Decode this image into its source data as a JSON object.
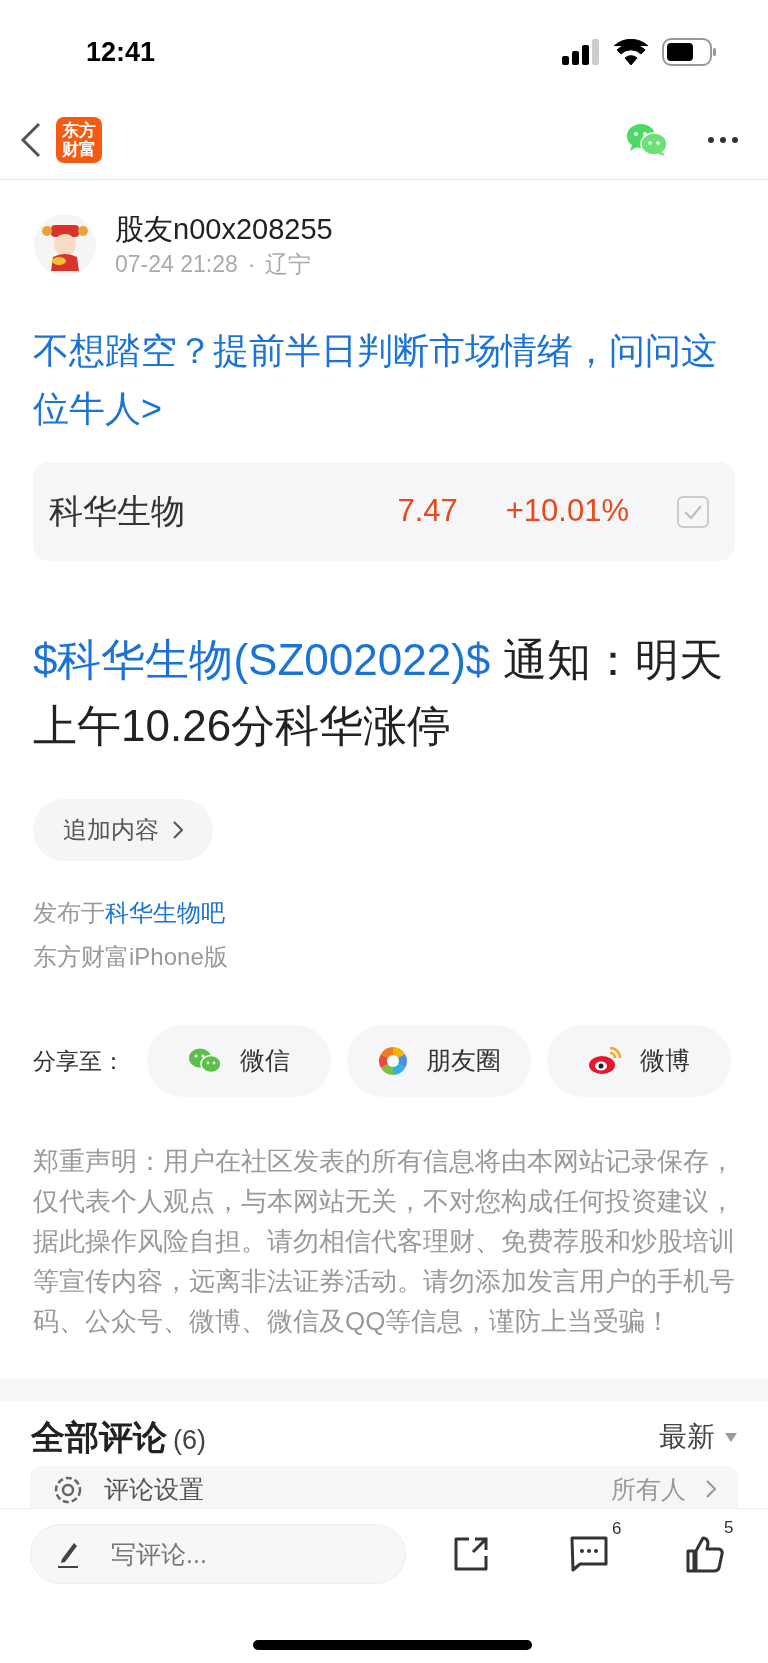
{
  "status_bar": {
    "time": "12:41"
  },
  "header": {
    "logo_lines": [
      "东方",
      "财富"
    ]
  },
  "author": {
    "name": "股友n00x208255",
    "date": "07-24 21:28",
    "dot": "·",
    "location": "辽宁"
  },
  "promo_link": "不想踏空？提前半日判断市场情绪，问问这位牛人>",
  "stock_card": {
    "name": "科华生物",
    "price": "7.47",
    "change": "+10.01%",
    "checked": true
  },
  "post": {
    "stock_tag": "$科华生物(SZ002022)$",
    "text": "通知：明天上午10.26分科华涨停"
  },
  "append_button": "追加内容",
  "published": {
    "prefix": "发布于",
    "forum": "科华生物吧"
  },
  "source": "东方财富iPhone版",
  "share": {
    "label": "分享至：",
    "targets": [
      {
        "kind": "wechat",
        "label": "微信"
      },
      {
        "kind": "moments",
        "label": "朋友圈"
      },
      {
        "kind": "weibo",
        "label": "微博"
      }
    ]
  },
  "disclaimer": "郑重声明：用户在社区发表的所有信息将由本网站记录保存，仅代表个人观点，与本网站无关，不对您构成任何投资建议，据此操作风险自担。请勿相信代客理财、免费荐股和炒股培训等宣传内容，远离非法证券活动。请勿添加发言用户的手机号码、公众号、微博、微信及QQ等信息，谨防上当受骗！",
  "comments": {
    "title": "全部评论",
    "count": "(6)",
    "sort": "最新",
    "settings_label": "评论设置",
    "settings_value": "所有人"
  },
  "bottom_bar": {
    "placeholder": "写评论...",
    "comment_count": "6",
    "like_count": "5"
  }
}
